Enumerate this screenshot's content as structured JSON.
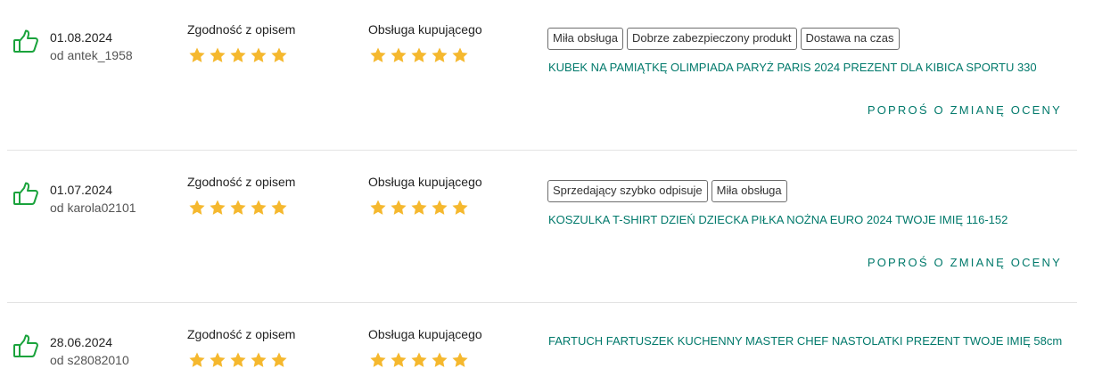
{
  "criteria": {
    "description": "Zgodność z opisem",
    "service": "Obsługa kupującego"
  },
  "colors": {
    "accent": "#00796b",
    "star": "#f5b82e",
    "thumb": "#1aa33c",
    "divider": "#e3e3e3"
  },
  "reviews": [
    {
      "date": "01.08.2024",
      "author": "od antek_1958",
      "rating_description": 5,
      "rating_service": 5,
      "tags": [
        "Miła obsługa",
        "Dobrze zabezpieczony produkt",
        "Dostawa na czas"
      ],
      "product": "KUBEK NA PAMIĄTKĘ OLIMPIADA PARYŻ PARIS 2024 PREZENT DLA KIBICA SPORTU 330",
      "action": "POPROŚ O ZMIANĘ OCENY"
    },
    {
      "date": "01.07.2024",
      "author": "od karola02101",
      "rating_description": 5,
      "rating_service": 5,
      "tags": [
        "Sprzedający szybko odpisuje",
        "Miła obsługa"
      ],
      "product": "KOSZULKA T-SHIRT DZIEŃ DZIECKA PIŁKA NOŻNA EURO 2024 TWOJE IMIĘ 116-152",
      "action": "POPROŚ O ZMIANĘ OCENY"
    },
    {
      "date": "28.06.2024",
      "author": "od s28082010",
      "rating_description": 5,
      "rating_service": 5,
      "tags": [],
      "product": "FARTUCH FARTUSZEK KUCHENNY MASTER CHEF NASTOLATKI PREZENT TWOJE IMIĘ 58cm",
      "action": ""
    }
  ]
}
